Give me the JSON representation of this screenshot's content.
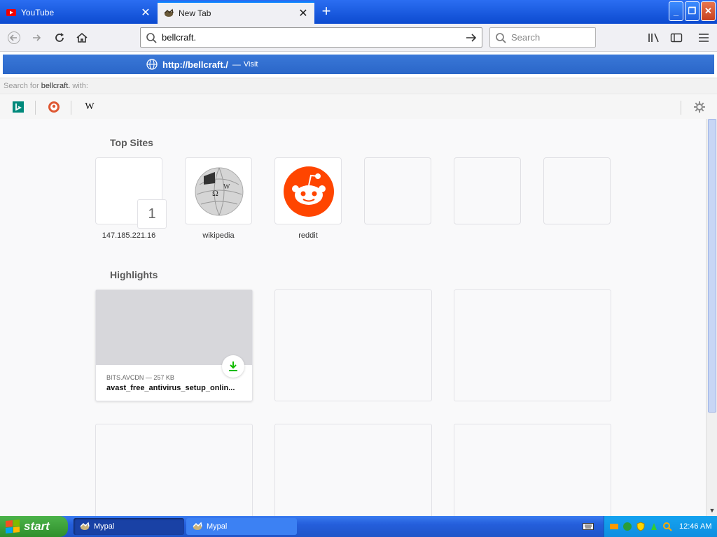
{
  "tabs": [
    {
      "title": "YouTube",
      "active": false
    },
    {
      "title": "New Tab",
      "active": true
    }
  ],
  "window_controls": {
    "minimize": "_",
    "restore": "❐",
    "close": "✕"
  },
  "urlbar": {
    "value": "bellcraft."
  },
  "searchbar": {
    "placeholder": "Search"
  },
  "autocomplete": {
    "url": "http://bellcraft./",
    "separator": "—",
    "action": "Visit",
    "search_for_prefix": "Search for",
    "search_for_query": "bellcraft.",
    "search_for_suffix": "with:",
    "engines": [
      "bing-icon",
      "duckduckgo-icon",
      "wikipedia-icon"
    ]
  },
  "top_sites": {
    "title": "Top Sites",
    "tiles": [
      {
        "label": "147.185.221.16",
        "rank": "1",
        "icon": "blank"
      },
      {
        "label": "wikipedia",
        "icon": "wikipedia-globe-icon"
      },
      {
        "label": "reddit",
        "icon": "reddit-icon"
      },
      {
        "label": "",
        "icon": "empty"
      },
      {
        "label": "",
        "icon": "empty"
      },
      {
        "label": "",
        "icon": "empty"
      }
    ]
  },
  "highlights": {
    "title": "Highlights",
    "cards": [
      {
        "host": "BITS.AVCDN — 257 KB",
        "name": "avast_free_antivirus_setup_onlin...",
        "badge": "download-icon"
      }
    ]
  },
  "taskbar": {
    "start_label": "start",
    "items": [
      {
        "label": "Mypal",
        "active": true
      },
      {
        "label": "Mypal",
        "active": false
      }
    ],
    "clock": "12:46 AM"
  },
  "colors": {
    "titlebar": "#245edb",
    "suggestion_highlight": "#2f6fd4",
    "reddit": "#ff4500",
    "start_green": "#3c9b37"
  }
}
